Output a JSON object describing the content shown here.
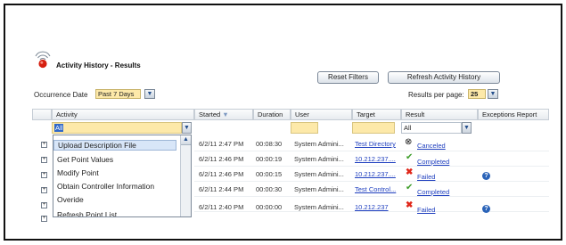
{
  "page": {
    "title": "Activity History - Results"
  },
  "toolbar": {
    "reset_label": "Reset Filters",
    "refresh_label": "Refresh Activity History"
  },
  "occurrence": {
    "label": "Occurrence Date",
    "value": "Past 7 Days"
  },
  "results_per_page": {
    "label": "Results per page:",
    "value": "25"
  },
  "columns": {
    "activity": "Activity",
    "started": "Started",
    "duration": "Duration",
    "user": "User",
    "target": "Target",
    "result": "Result",
    "exceptions": "Exceptions Report"
  },
  "filters": {
    "activity": "All",
    "result": "All"
  },
  "activity_dropdown": {
    "items": [
      "Upload Description File",
      "Get Point Values",
      "Modify Point",
      "Obtain Controller Information",
      "Overide",
      "Refresh Point List"
    ]
  },
  "rows": [
    {
      "started": "6/2/11 2:47 PM",
      "duration": "00:08:30",
      "user": "System Admini...",
      "target": "Test Directory",
      "result": "Canceled",
      "result_icon": "cancel-icon"
    },
    {
      "started": "6/2/11 2:46 PM",
      "duration": "00:00:19",
      "user": "System Admini...",
      "target": "10.212.237....",
      "result": "Completed",
      "result_icon": "check-icon"
    },
    {
      "started": "6/2/11 2:46 PM",
      "duration": "00:00:15",
      "user": "System Admini...",
      "target": "10.212.237....",
      "result": "Failed",
      "result_icon": "x-icon"
    },
    {
      "started": "6/2/11 2:44 PM",
      "duration": "00:00:30",
      "user": "System Admini...",
      "target": "Test Control...",
      "result": "Completed",
      "result_icon": "check-icon"
    },
    {
      "started": "6/2/11 2:40 PM",
      "duration": "00:00:00",
      "user": "System Admini...",
      "target": "10.212.237",
      "result": "Failed",
      "result_icon": "x-icon"
    }
  ],
  "colors": {
    "filter_bg": "#fde9a9",
    "link": "#1f3fbf",
    "selected_bg": "#d8e6f8",
    "success": "#3f9e2b",
    "fail": "#e0271a",
    "help": "#2a63b8"
  }
}
